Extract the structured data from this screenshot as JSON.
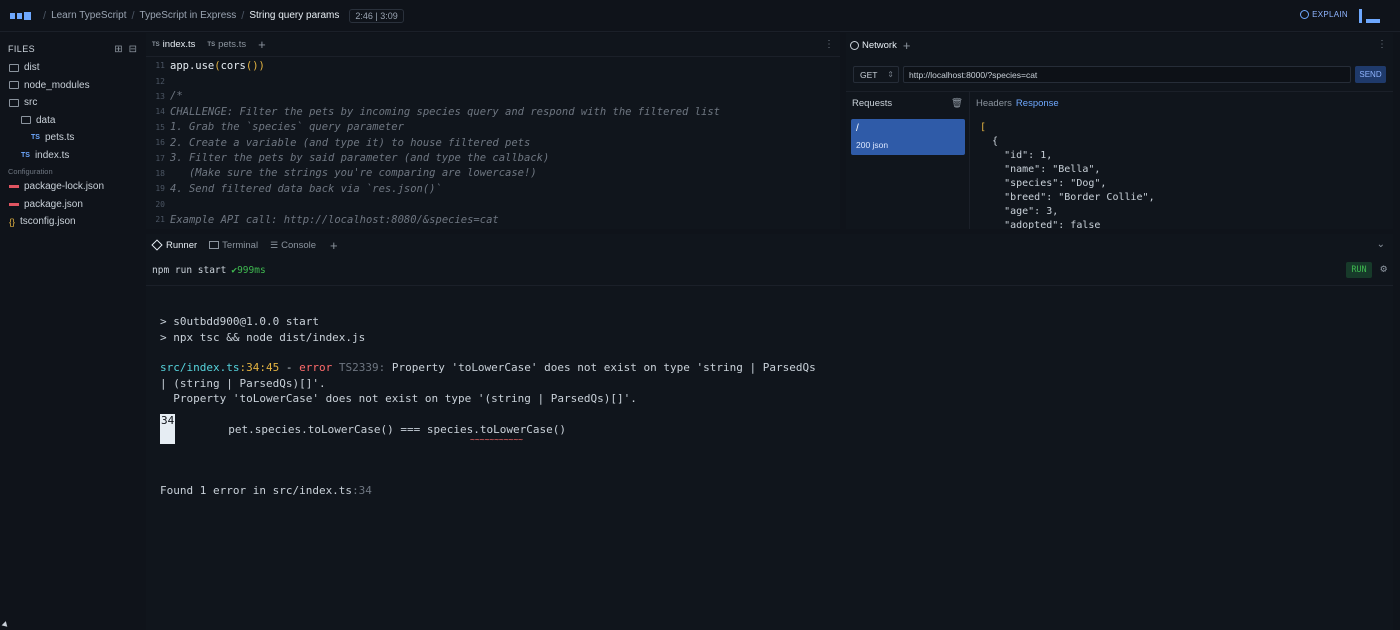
{
  "topbar": {
    "breadcrumbs": [
      "Learn TypeScript",
      "TypeScript in Express",
      "String query params"
    ],
    "timer": "2:46 | 3:09",
    "explain_label": "EXPLAIN"
  },
  "sidebar": {
    "title": "FILES",
    "items": [
      {
        "label": "dist",
        "type": "folder"
      },
      {
        "label": "node_modules",
        "type": "folder"
      },
      {
        "label": "src",
        "type": "folder-open"
      },
      {
        "label": "data",
        "type": "folder"
      },
      {
        "label": "pets.ts",
        "type": "ts"
      },
      {
        "label": "index.ts",
        "type": "ts"
      }
    ],
    "config_label": "Configuration",
    "config_items": [
      {
        "label": "package-lock.json",
        "type": "json"
      },
      {
        "label": "package.json",
        "type": "json"
      },
      {
        "label": "tsconfig.json",
        "type": "config"
      }
    ]
  },
  "editor": {
    "tabs": [
      {
        "label": "index.ts",
        "badge": "TS",
        "active": true
      },
      {
        "label": "pets.ts",
        "badge": "TS",
        "active": false
      }
    ],
    "lines": [
      {
        "n": "11",
        "text": "app.use(cors())",
        "kind": "code"
      },
      {
        "n": "12",
        "text": "",
        "kind": "code"
      },
      {
        "n": "13",
        "text": "/*",
        "kind": "comment"
      },
      {
        "n": "14",
        "text": "CHALLENGE: Filter the pets by incoming species query and respond with the filtered list",
        "kind": "comment"
      },
      {
        "n": "15",
        "text": "1. Grab the `species` query parameter",
        "kind": "comment"
      },
      {
        "n": "16",
        "text": "2. Create a variable (and type it) to house filtered pets",
        "kind": "comment"
      },
      {
        "n": "17",
        "text": "3. Filter the pets by said parameter (and type the callback)",
        "kind": "comment"
      },
      {
        "n": "18",
        "text": "   (Make sure the strings you're comparing are lowercase!)",
        "kind": "comment"
      },
      {
        "n": "19",
        "text": "4. Send filtered data back via `res.json()`",
        "kind": "comment"
      },
      {
        "n": "20",
        "text": "",
        "kind": "comment"
      },
      {
        "n": "21",
        "text": "Example API call: http://localhost:8080/&species=cat",
        "kind": "comment"
      }
    ]
  },
  "network": {
    "tab_label": "Network",
    "method": "GET",
    "url": "http://localhost:8000/?species=cat",
    "send_label": "SEND",
    "requests_label": "Requests",
    "request": {
      "path": "/",
      "status": "200 json"
    },
    "headers_label": "Headers",
    "response_label": "Response",
    "response_lines": [
      "[",
      "  {",
      "    \"id\": 1,",
      "    \"name\": \"Bella\",",
      "    \"species\": \"Dog\",",
      "    \"breed\": \"Border Collie\",",
      "    \"age\": 3,",
      "    \"adopted\": false"
    ]
  },
  "bottom": {
    "tabs": [
      {
        "label": "Runner",
        "active": true
      },
      {
        "label": "Terminal",
        "active": false
      },
      {
        "label": "Console",
        "active": false
      }
    ],
    "command": "npm run start",
    "command_time": "✔999ms",
    "run_label": "RUN",
    "terminal": {
      "l1": "> s0utbdd900@1.0.0 start",
      "l2": "> npx tsc && node dist/index.js",
      "err_file": "src/index.ts",
      "err_pos": ":34:45",
      "err_dash": " - ",
      "err_word": "error",
      "err_code": " TS2339: ",
      "err_msg": "Property 'toLowerCase' does not exist on type 'string | ParsedQs",
      "err_msg2": "| (string | ParsedQs)[]'.",
      "err_msg3": "  Property 'toLowerCase' does not exist on type '(string | ParsedQs)[]'.",
      "line_num": "34",
      "code_line": "        pet.species.toLowerCase() === species.toLowerCase()",
      "squiggle": "~~~~~~~~~~~",
      "found": "Found 1 error in src/index.ts",
      "found_loc": ":34"
    }
  }
}
